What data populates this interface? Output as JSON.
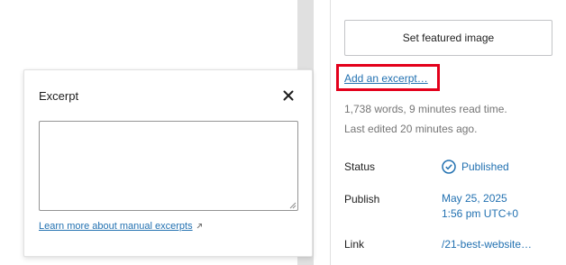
{
  "excerpt_popover": {
    "title": "Excerpt",
    "textarea_value": "",
    "learn_more_link": "Learn more about manual excerpts"
  },
  "sidebar": {
    "featured_image_button": "Set featured image",
    "add_excerpt_link": "Add an excerpt…",
    "word_count": "1,738 words, 9 minutes read time.",
    "last_edited": "Last edited 20 minutes ago.",
    "rows": {
      "status": {
        "label": "Status",
        "value": "Published"
      },
      "publish": {
        "label": "Publish",
        "date": "May 25, 2025",
        "time": "1:56 pm UTC+0"
      },
      "link": {
        "label": "Link",
        "value": "/21-best-website…"
      }
    }
  },
  "colors": {
    "link": "#2271b1",
    "highlight": "#e3001b",
    "muted_text": "#757575"
  }
}
